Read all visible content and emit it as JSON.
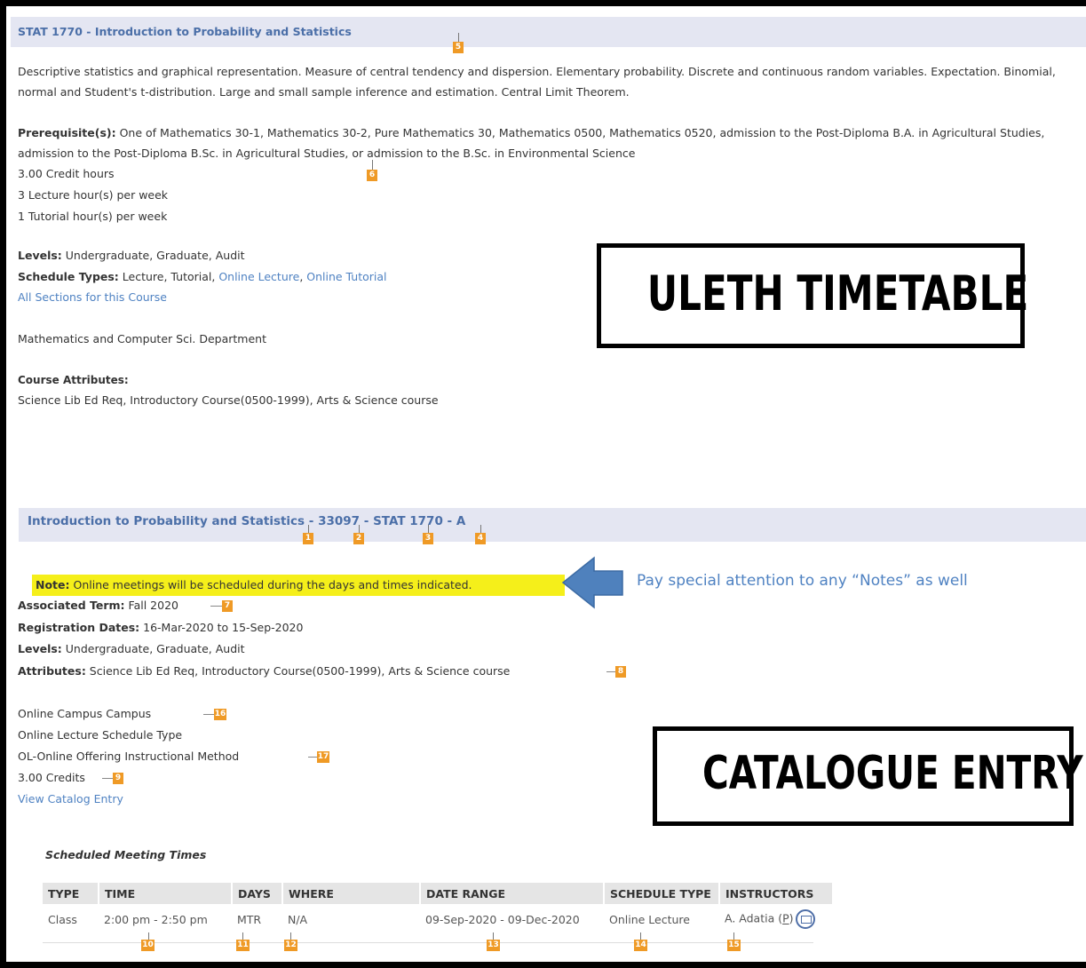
{
  "course_header": {
    "title": "STAT 1770 - Introduction to Probability and Statistics"
  },
  "description": "Descriptive statistics and graphical representation. Measure of central tendency and dispersion. Elementary probability. Discrete and continuous random variables. Expectation. Binomial, normal and Student's t-distribution. Large and small sample inference and estimation. Central Limit Theorem.",
  "prereq": {
    "label": "Prerequisite(s):",
    "text": " One of Mathematics 30-1, Mathematics 30-2, Pure Mathematics 30, Mathematics 0500, Mathematics 0520, admission to the Post-Diploma B.A. in Agricultural Studies, admission to the Post-Diploma B.Sc. in Agricultural Studies, or admission to the B.Sc. in Environmental Science"
  },
  "hours": [
    "3.00 Credit hours",
    "3 Lecture hour(s) per week",
    "1 Tutorial hour(s) per week"
  ],
  "levels": {
    "label": "Levels:",
    "value": " Undergraduate, Graduate, Audit"
  },
  "schedule_types": {
    "label": "Schedule Types:",
    "plain": " Lecture, Tutorial, ",
    "link1": "Online Lecture",
    "sep": ", ",
    "link2": "Online Tutorial"
  },
  "all_sections_link": "All Sections for this Course",
  "department": "Mathematics and Computer Sci. Department",
  "course_attributes": {
    "label": "Course Attributes:",
    "value": "Science Lib Ed Req, Introductory Course(0500-1999), Arts & Science course"
  },
  "label_top": "ULETH TIMETABLE",
  "section_header": {
    "title": "Introduction to Probability and Statistics - 33097 - STAT 1770 - A"
  },
  "note": {
    "label": "Note:",
    "text": " Online meetings will be scheduled during the days and times indicated."
  },
  "callout": "Pay special attention to any “Notes” as well",
  "section_info": {
    "term_label": "Associated Term:",
    "term_value": " Fall 2020",
    "reg_label": "Registration Dates:",
    "reg_value": " 16-Mar-2020 to 15-Sep-2020",
    "levels_label": "Levels:",
    "levels_value": " Undergraduate, Graduate, Audit",
    "attr_label": "Attributes:",
    "attr_value": " Science Lib Ed Req, Introductory Course(0500-1999), Arts & Science course"
  },
  "delivery": {
    "campus": "Online Campus Campus",
    "schedule_type": "Online Lecture Schedule Type",
    "method": "OL-Online Offering Instructional Method",
    "credits": "3.00 Credits",
    "catalog_link": "View Catalog Entry"
  },
  "label_bottom": "CATALOGUE ENTRY",
  "meeting_times": {
    "title": "Scheduled Meeting Times",
    "headers": [
      "TYPE",
      "TIME",
      "DAYS",
      "WHERE",
      "DATE RANGE",
      "SCHEDULE TYPE",
      "INSTRUCTORS"
    ],
    "row": {
      "type": "Class",
      "time": "2:00 pm - 2:50 pm",
      "days": "MTR",
      "where": "N/A",
      "date_range": "09-Sep-2020 - 09-Dec-2020",
      "schedule_type": "Online Lecture",
      "instructor": "A. Adatia (",
      "primary": "P",
      "instructor_end": ")"
    }
  },
  "badges": {
    "b1": "1",
    "b2": "2",
    "b3": "3",
    "b4": "4",
    "b5": "5",
    "b6": "6",
    "b7": "7",
    "b8": "8",
    "b9": "9",
    "b10": "10",
    "b11": "11",
    "b12": "12",
    "b13": "13",
    "b14": "14",
    "b15": "15",
    "b16": "16",
    "b17": "17"
  },
  "colors": {
    "badge": "#ef9a26",
    "header_band": "#e4e6f2",
    "link": "#4f82c2",
    "highlight": "#f5ef1a",
    "arrow": "#4f81bd"
  },
  "icons": {
    "email": "email-envelope-icon",
    "arrow": "left-arrow-icon"
  }
}
